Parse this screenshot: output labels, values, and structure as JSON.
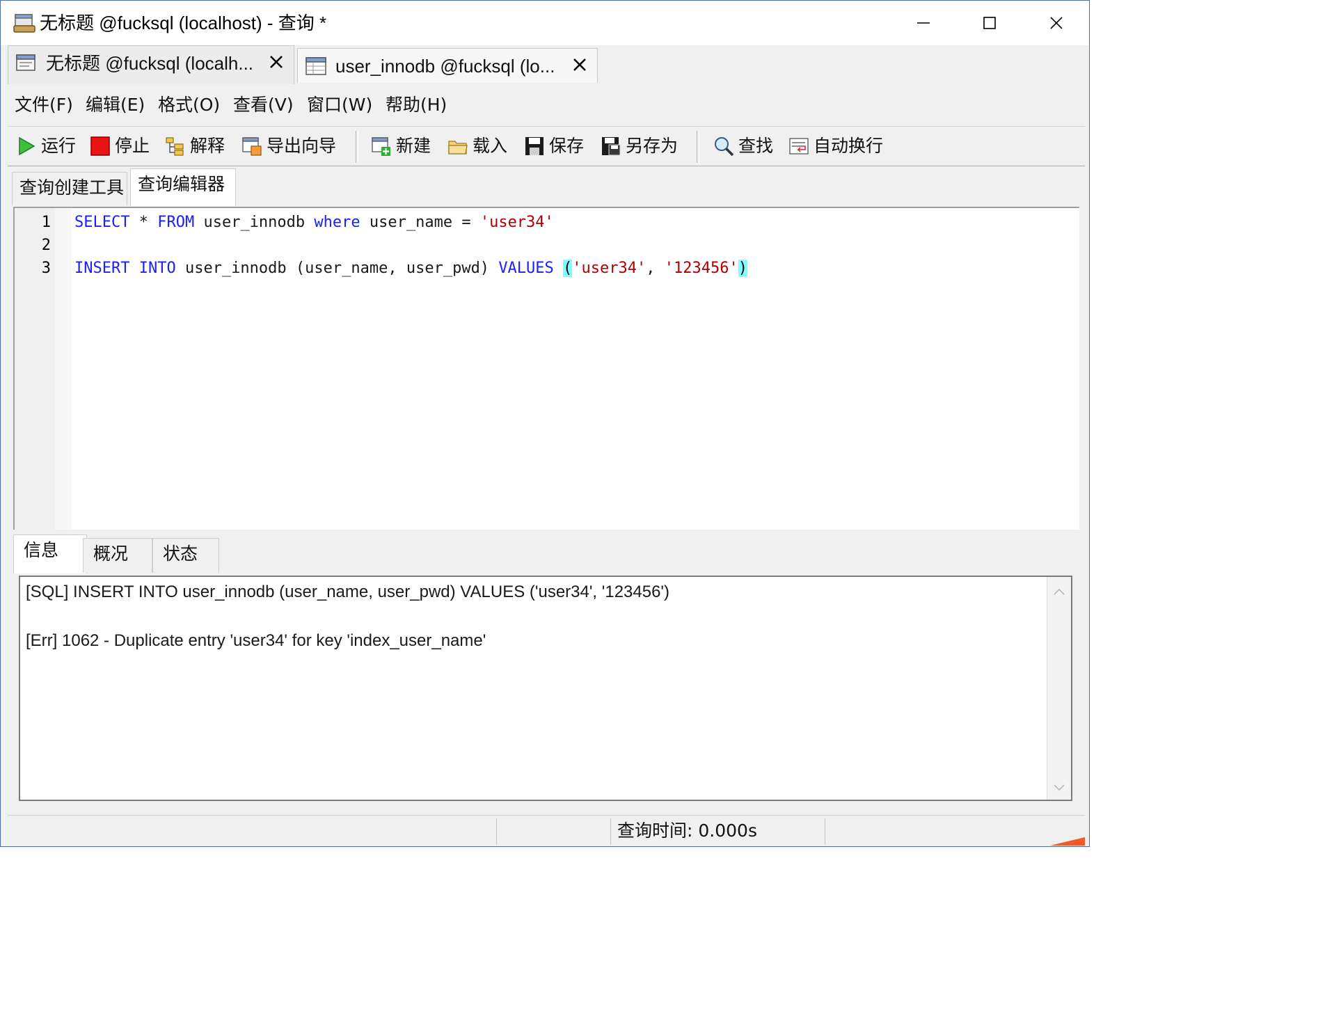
{
  "window": {
    "title": "无标题 @fucksql (localhost) - 查询 *",
    "minimize_icon": "minimize-icon",
    "maximize_icon": "maximize-icon",
    "close_icon": "close-icon"
  },
  "doc_tabs": [
    {
      "label": "无标题 @fucksql (localh...",
      "icon": "query-icon",
      "active": true
    },
    {
      "label": "user_innodb @fucksql (lo...",
      "icon": "table-icon",
      "active": false
    }
  ],
  "menu": {
    "file": "文件(F)",
    "edit": "编辑(E)",
    "format": "格式(O)",
    "view": "查看(V)",
    "window": "窗口(W)",
    "help": "帮助(H)"
  },
  "toolbar": {
    "run": "运行",
    "stop": "停止",
    "explain": "解释",
    "export_wizard": "导出向导",
    "new": "新建",
    "load": "载入",
    "save": "保存",
    "save_as": "另存为",
    "find": "查找",
    "word_wrap": "自动换行"
  },
  "sub_tabs": {
    "query_builder": "查询创建工具",
    "query_editor": "查询编辑器"
  },
  "editor": {
    "line_numbers": [
      "1",
      "2",
      "3"
    ],
    "line1": {
      "kw_select": "SELECT",
      "star": " * ",
      "kw_from": "FROM",
      "table": " user_innodb ",
      "kw_where": "where",
      "cond": " user_name = ",
      "value": "'user34'"
    },
    "line3": {
      "kw_insert": "INSERT",
      "sp1": " ",
      "kw_into": "INTO",
      "rest": " user_innodb (user_name, user_pwd) ",
      "kw_values": "VALUES",
      "sp2": " ",
      "open_paren": "(",
      "v1": "'user34'",
      "comma": ", ",
      "v2": "'123456'",
      "close_paren": ")"
    }
  },
  "result_tabs": {
    "info": "信息",
    "overview": "概况",
    "status": "状态"
  },
  "messages": {
    "sql": "[SQL] INSERT INTO user_innodb (user_name, user_pwd) VALUES ('user34', '123456')",
    "err": "[Err] 1062 - Duplicate entry 'user34' for key 'index_user_name'"
  },
  "statusbar": {
    "query_time": "查询时间: 0.000s"
  },
  "colors": {
    "keyword": "#1a20ff",
    "string": "#b00000",
    "bracket_highlight": "#7fffff"
  }
}
